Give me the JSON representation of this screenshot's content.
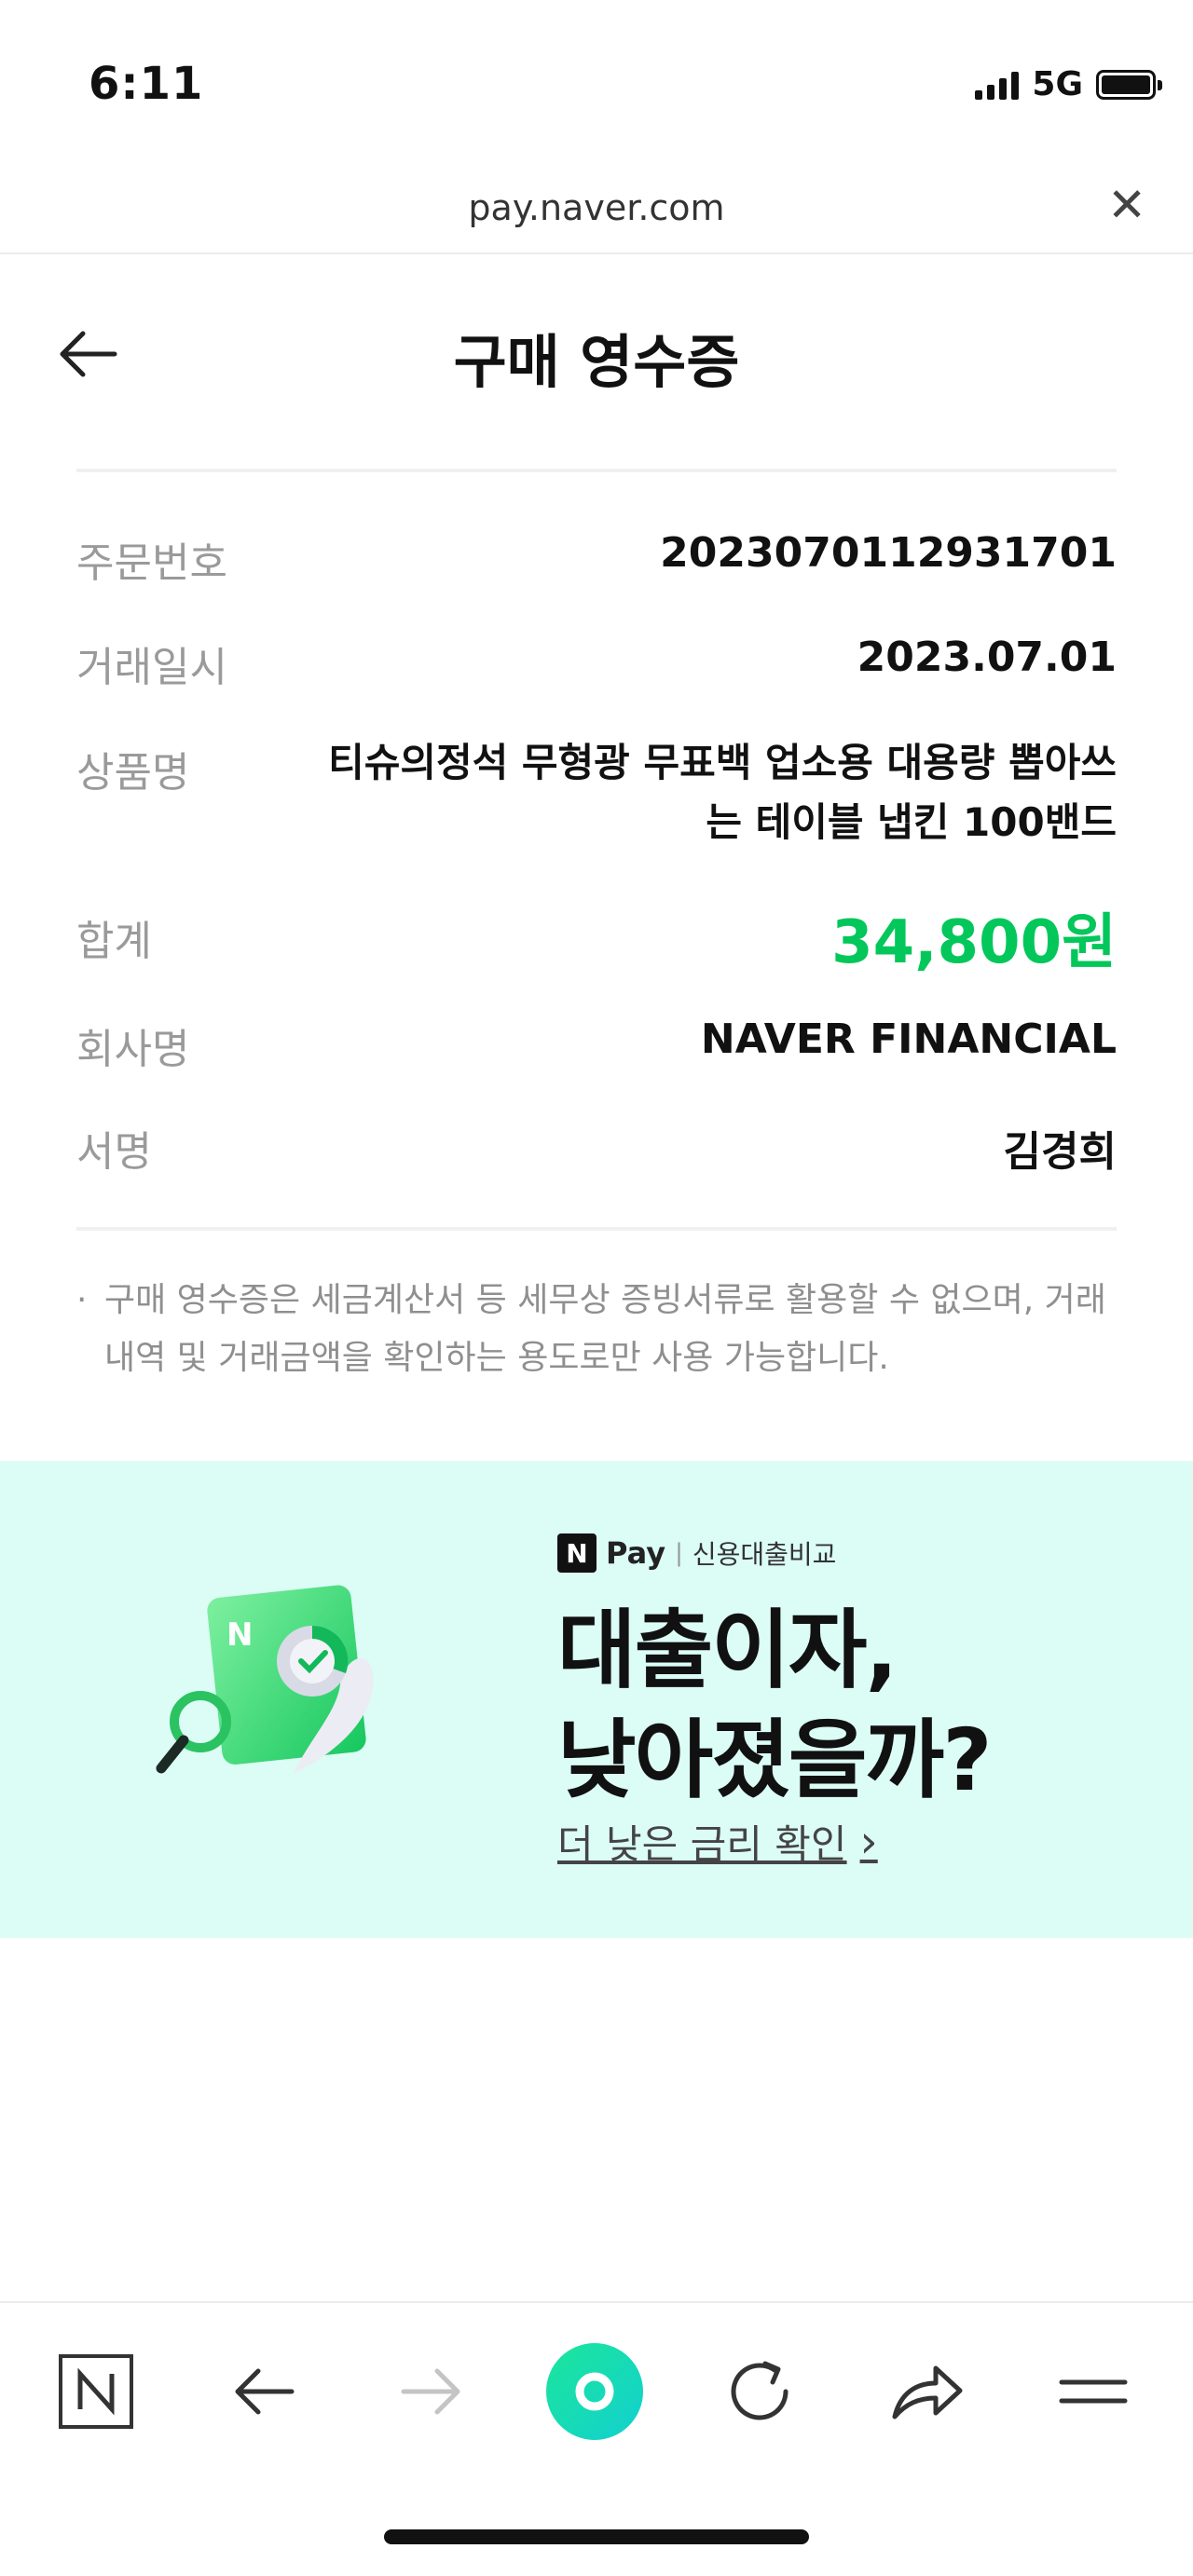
{
  "status_bar": {
    "time": "6:11",
    "network": "5G"
  },
  "browser": {
    "url": "pay.naver.com",
    "close_icon": "close-icon"
  },
  "header": {
    "title": "구매 영수증",
    "back_icon": "arrow-left-icon"
  },
  "receipt": {
    "order_number": {
      "label": "주문번호",
      "value": "2023070112931701"
    },
    "transaction_date": {
      "label": "거래일시",
      "value": "2023.07.01"
    },
    "product_name": {
      "label": "상품명",
      "value": "티슈의정석 무형광 무표백 업소용 대용량 뽑아쓰는 테이블 냅킨 100밴드"
    },
    "total": {
      "label": "합계",
      "value": "34,800원",
      "color": "#03c75a"
    },
    "company": {
      "label": "회사명",
      "value": "NAVER FINANCIAL"
    },
    "signature": {
      "label": "서명",
      "value": "김경희"
    }
  },
  "notice": {
    "bullet": "·",
    "text": "구매 영수증은 세금계산서 등 세무상 증빙서류로 활용할 수 없으며, 거래내역 및 거래금액을 확인하는 용도로만 사용 가능합니다."
  },
  "banner": {
    "brand_n": "N",
    "brand_pay": "Pay",
    "brand_sep": "|",
    "brand_sub": "신용대출비교",
    "headline_line1": "대출이자,",
    "headline_line2": "낮아졌을까?",
    "link_text": "더 낮은 금리 확인",
    "link_chevron": "›",
    "background": "#dcfcf6"
  },
  "toolbar": {
    "icons": [
      "naver-home-icon",
      "back-arrow-icon",
      "forward-arrow-icon",
      "green-dot-icon",
      "refresh-icon",
      "share-icon",
      "menu-icon"
    ],
    "accent": "#19e6b0"
  }
}
